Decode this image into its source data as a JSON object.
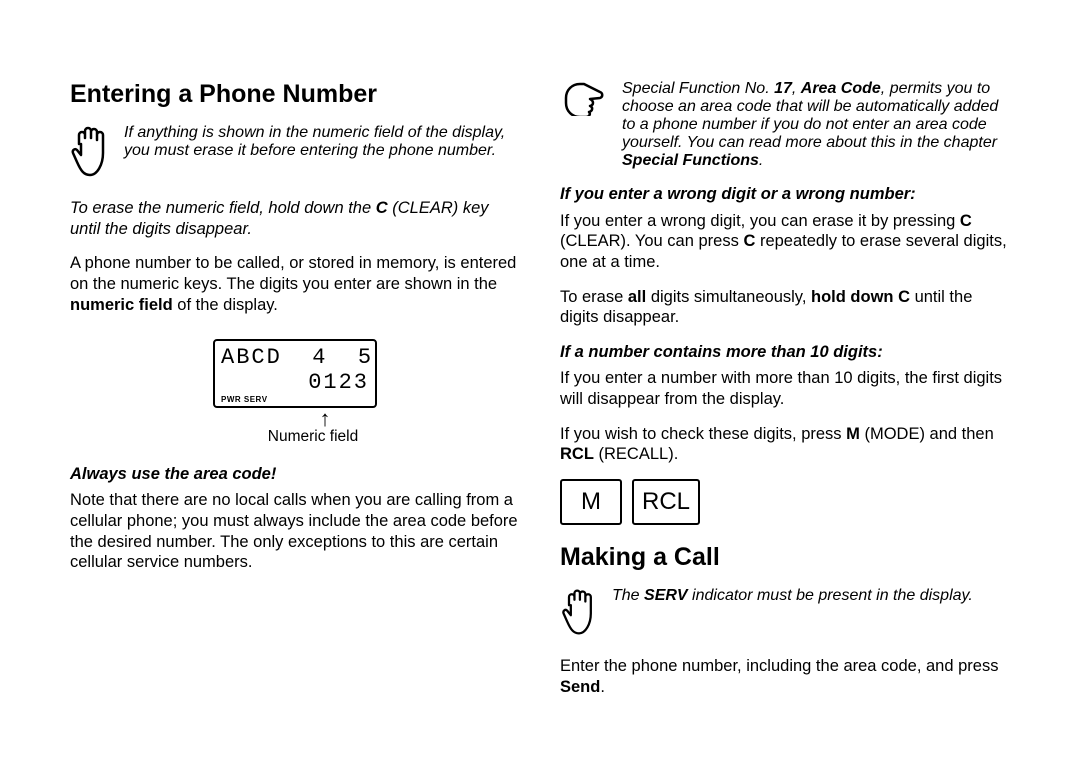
{
  "left": {
    "h1": "Entering a Phone Number",
    "note1_a": "If anything is shown in the numeric field of the display, you must erase it before entering the phone number.",
    "erase_a": "To erase the numeric field, hold down the ",
    "erase_c": "C",
    "erase_b": " (CLEAR) key until the digits disappear.",
    "p1_a": "A phone number to be called, or stored in memory, is entered on the numeric keys. The digits you enter are shown in the ",
    "p1_bold": "numeric field",
    "p1_b": " of the display.",
    "lcd_row1": "ABCD  4  5",
    "lcd_row2": "0123",
    "lcd_status": "PWR  SERV",
    "arrow": "↑",
    "caption": "Numeric field",
    "sub1": "Always use the area code!",
    "p2": "Note that there are no local calls when you are calling from a cellular phone; you must always include the area code before the desired number. The only exceptions to this are certain cellular service numbers."
  },
  "right": {
    "tip_a": "Special Function No. ",
    "tip_num": "17",
    "tip_b": ", ",
    "tip_ac": "Area Code",
    "tip_c": ", permits you to choose an area code that will be automatically added to a phone number if you do not enter an area code yourself. You can read more about this in the chapter ",
    "tip_sf": "Special Functions",
    "tip_d": ".",
    "sub1": "If you enter a wrong digit or a wrong number:",
    "p1_a": "If you enter a wrong digit, you can erase it by pressing ",
    "p1_c1": "C",
    "p1_b": " (CLEAR). You can press ",
    "p1_c2": "C",
    "p1_c": " repeatedly to erase several digits, one at a time.",
    "p2_a": "To erase ",
    "p2_all": "all",
    "p2_b": " digits simultaneously, ",
    "p2_hold": "hold down C",
    "p2_c": " until the digits disappear.",
    "sub2": "If a number contains more than 10 digits:",
    "p3": "If you enter a number with more than 10 digits, the first digits will disappear from the display.",
    "p4_a": "If you wish to check these digits, press ",
    "p4_m": "M",
    "p4_b": " (MODE) and then ",
    "p4_rcl": "RCL",
    "p4_c": " (RECALL).",
    "key_m": "M",
    "key_rcl": "RCL",
    "h2": "Making a Call",
    "call_note_a": "The ",
    "call_note_serv": "SERV",
    "call_note_b": " indicator must be present in the display.",
    "p5_a": "Enter the phone number, including the area code, and press ",
    "p5_send": "Send",
    "p5_b": "."
  }
}
